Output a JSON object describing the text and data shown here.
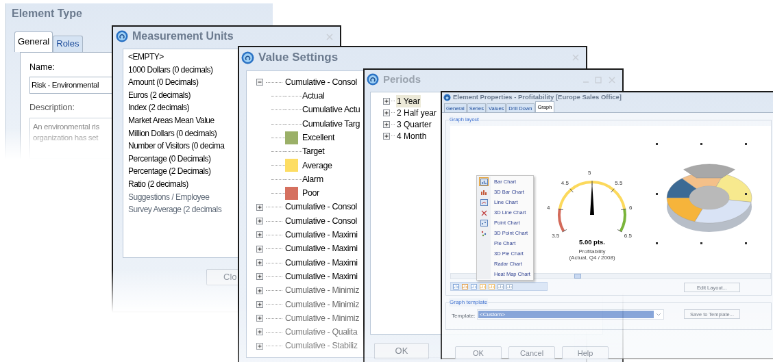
{
  "element_type": {
    "title": "Element Type",
    "tabs": [
      {
        "label": "General",
        "selected": true
      },
      {
        "label": "Roles",
        "selected": false
      }
    ],
    "name_label": "Name:",
    "name_value": "Risk - Environmental",
    "description_label": "Description:",
    "description_lines": [
      "An environmental ris",
      "organization has set"
    ]
  },
  "measurement_units": {
    "title": "Measurement Units",
    "items": [
      {
        "label": "<EMPTY>"
      },
      {
        "label": "1000 Dollars (0 decimals)"
      },
      {
        "label": "Amount (0 Decimals)"
      },
      {
        "label": "Euros (2 decimals)"
      },
      {
        "label": "Index (2 decimals)"
      },
      {
        "label": "Market Areas Mean Value"
      },
      {
        "label": "Million Dollars (0 decimals)"
      },
      {
        "label": "Number of Visitors (0 decima"
      },
      {
        "label": "Percentage (0 Decimals)"
      },
      {
        "label": "Percentage (2 Decimals)"
      },
      {
        "label": "Ratio (2 decimals)"
      },
      {
        "label": "Suggestions / Employee"
      },
      {
        "label": "Survey Average (2 decimals"
      }
    ],
    "close_button": "Clo"
  },
  "value_settings": {
    "title": "Value Settings",
    "tree": [
      {
        "label": "Cumulative - Consol",
        "expanded": true,
        "children": [
          {
            "label": "Actual"
          },
          {
            "label": "Cumulative Actu"
          },
          {
            "label": "Cumulative Targ"
          },
          {
            "label": "Excellent",
            "color": "#9bb068"
          },
          {
            "label": "Target"
          },
          {
            "label": "Average",
            "color": "#fddd63"
          },
          {
            "label": "Alarm"
          },
          {
            "label": "Poor",
            "color": "#d5705f"
          }
        ]
      },
      {
        "label": "Cumulative - Consol",
        "expanded": false
      },
      {
        "label": "Cumulative - Consol",
        "expanded": false
      },
      {
        "label": "Cumulative - Maximi",
        "expanded": false
      },
      {
        "label": "Cumulative - Maximi",
        "expanded": false
      },
      {
        "label": "Cumulative - Maximi",
        "expanded": false
      },
      {
        "label": "Cumulative - Maximi",
        "expanded": false
      },
      {
        "label": "Cumulative - Minimiz",
        "expanded": false
      },
      {
        "label": "Cumulative - Minimiz",
        "expanded": false
      },
      {
        "label": "Cumulative - Minimiz",
        "expanded": false
      },
      {
        "label": "Cumulative - Qualita",
        "expanded": false
      },
      {
        "label": "Cumulative - Stabiliz",
        "expanded": false
      }
    ]
  },
  "periods": {
    "title": "Periods",
    "tree": [
      {
        "label": "1 Year",
        "expanded": false,
        "selected": true
      },
      {
        "label": "2 Half year",
        "expanded": false,
        "selected": false
      },
      {
        "label": "3 Quarter",
        "expanded": false,
        "selected": false
      },
      {
        "label": "4 Month",
        "expanded": false,
        "selected": false
      }
    ],
    "ok_button": "OK"
  },
  "element_properties": {
    "title": "Element Properties - Profitability [Europe Sales Office]",
    "tabs": [
      {
        "label": "General",
        "selected": false
      },
      {
        "label": "Series",
        "selected": false
      },
      {
        "label": "Values",
        "selected": false
      },
      {
        "label": "Drill Down",
        "selected": false
      },
      {
        "label": "Graph",
        "selected": true
      }
    ],
    "graph_layout": {
      "legend": "Graph layout",
      "gauge": {
        "ticks": [
          "3.5",
          "4",
          "4.5",
          "5",
          "5.5",
          "6",
          "6.5"
        ],
        "value": "5.00 pts.",
        "caption": "Profitability",
        "subcaption": "(Actual, Q4 / 2008)"
      },
      "chart_menu": [
        {
          "label": "Bar Chart",
          "kind": "bar",
          "selected": true
        },
        {
          "label": "3D Bar Chart",
          "kind": "bar3d",
          "selected": false
        },
        {
          "label": "Line Chart",
          "kind": "line",
          "selected": false
        },
        {
          "label": "3D Line Chart",
          "kind": "line3d",
          "selected": false
        },
        {
          "label": "Point Chart",
          "kind": "point",
          "selected": false
        },
        {
          "label": "3D Point Chart",
          "kind": "point3d",
          "selected": false
        },
        {
          "label": "Pie Chart",
          "kind": "plain",
          "selected": false
        },
        {
          "label": "3D Pie Chart",
          "kind": "plain",
          "selected": false
        },
        {
          "label": "Radar Chart",
          "kind": "plain",
          "selected": false
        },
        {
          "label": "Heat Map Chart",
          "kind": "plain",
          "selected": false
        }
      ],
      "edit_layout_button": "Edit Layout..."
    },
    "graph_template": {
      "legend": "Graph template",
      "template_label": "Template:",
      "template_value": "<Custom>",
      "save_button": "Save to Template..."
    },
    "buttons": [
      "OK",
      "Cancel",
      "Help"
    ]
  }
}
